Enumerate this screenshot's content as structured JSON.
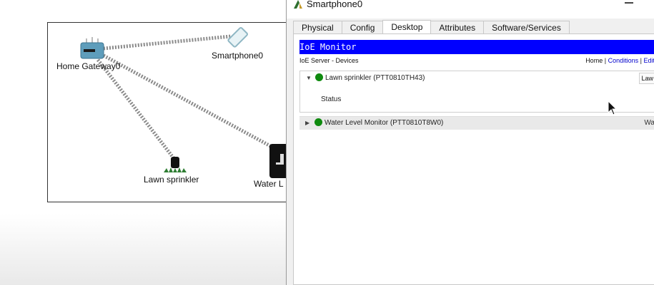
{
  "workspace": {
    "devices": {
      "home_gateway": "Home Gateway0",
      "smartphone": "Smartphone0",
      "lawn_sprinkler": "Lawn sprinkler",
      "water_level": "Water L"
    }
  },
  "window": {
    "title": "Smartphone0",
    "tabs": [
      {
        "label": "Physical"
      },
      {
        "label": "Config"
      },
      {
        "label": "Desktop",
        "active": true
      },
      {
        "label": "Attributes"
      },
      {
        "label": "Software/Services"
      }
    ]
  },
  "ioe": {
    "header": "IoE Monitor",
    "subtitle": "IoE Server - Devices",
    "nav": {
      "home": "Home",
      "separator": "|",
      "conditions": "Conditions",
      "edit": "Edit"
    },
    "devices": [
      {
        "name": "Lawn sprinkler (PTT0810TH43)",
        "status_color": "#0f8a0f",
        "expanded": true,
        "right_tag": "Law",
        "detail_label": "Status"
      },
      {
        "name": "Water Level Monitor (PTT0810T8W0)",
        "status_color": "#0f8a0f",
        "expanded": false,
        "right_text": "Wa"
      }
    ]
  },
  "colors": {
    "ioe_header_bg": "#0000ff",
    "status_ok": "#0f8a0f",
    "link": "#0000cc"
  }
}
